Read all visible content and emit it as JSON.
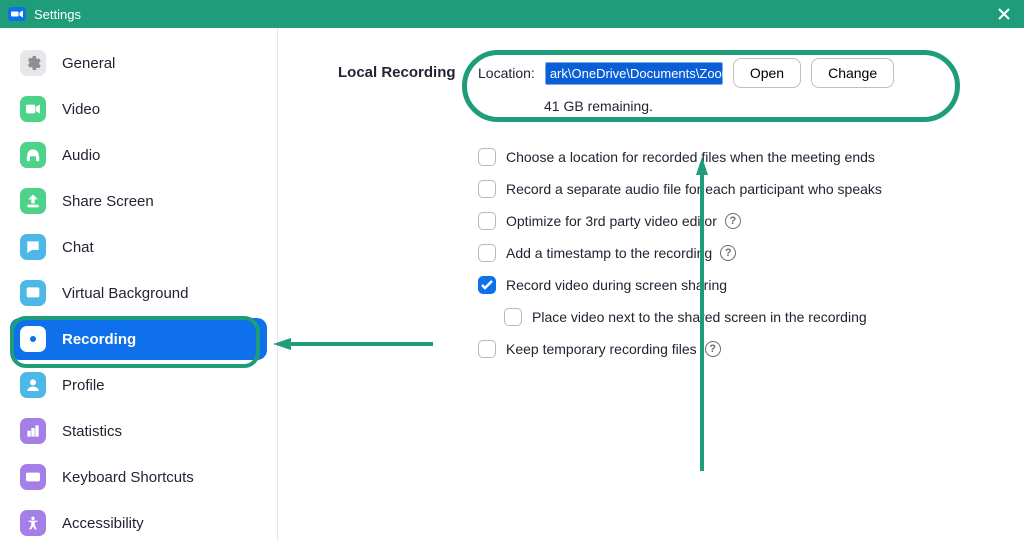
{
  "window": {
    "title": "Settings"
  },
  "sidebar": {
    "items": [
      {
        "label": "General",
        "icon": "gear",
        "active": false,
        "bg": "#e7e7ea",
        "fg": "#9aa0a6"
      },
      {
        "label": "Video",
        "icon": "video",
        "active": false,
        "bg": "#4dd28a",
        "fg": "#fff"
      },
      {
        "label": "Audio",
        "icon": "headphones",
        "active": false,
        "bg": "#4dd28a",
        "fg": "#fff"
      },
      {
        "label": "Share Screen",
        "icon": "share",
        "active": false,
        "bg": "#4dd28a",
        "fg": "#fff"
      },
      {
        "label": "Chat",
        "icon": "chat",
        "active": false,
        "bg": "#4db7e8",
        "fg": "#fff"
      },
      {
        "label": "Virtual Background",
        "icon": "image",
        "active": false,
        "bg": "#4db7e8",
        "fg": "#fff"
      },
      {
        "label": "Recording",
        "icon": "record",
        "active": true,
        "bg": "#0e71eb",
        "fg": "#fff"
      },
      {
        "label": "Profile",
        "icon": "person",
        "active": false,
        "bg": "#4db7e8",
        "fg": "#fff"
      },
      {
        "label": "Statistics",
        "icon": "stats",
        "active": false,
        "bg": "#a57fe8",
        "fg": "#fff"
      },
      {
        "label": "Keyboard Shortcuts",
        "icon": "keyboard",
        "active": false,
        "bg": "#a57fe8",
        "fg": "#fff"
      },
      {
        "label": "Accessibility",
        "icon": "access",
        "active": false,
        "bg": "#a57fe8",
        "fg": "#fff"
      }
    ]
  },
  "recording": {
    "section_label": "Local Recording",
    "location_label": "Location:",
    "location_path": "ark\\OneDrive\\Documents\\Zoom",
    "open_btn": "Open",
    "change_btn": "Change",
    "remaining": "41 GB remaining.",
    "options": [
      {
        "label": "Choose a location for recorded files when the meeting ends",
        "checked": false,
        "help": false,
        "indent": false
      },
      {
        "label": "Record a separate audio file for each participant who speaks",
        "checked": false,
        "help": false,
        "indent": false
      },
      {
        "label": "Optimize for 3rd party video editor",
        "checked": false,
        "help": true,
        "indent": false
      },
      {
        "label": "Add a timestamp to the recording",
        "checked": false,
        "help": true,
        "indent": false
      },
      {
        "label": "Record video during screen sharing",
        "checked": true,
        "help": false,
        "indent": false
      },
      {
        "label": "Place video next to the shared screen in the recording",
        "checked": false,
        "help": false,
        "indent": true
      },
      {
        "label": "Keep temporary recording files",
        "checked": false,
        "help": true,
        "indent": false
      }
    ]
  },
  "annotations": {
    "color": "#1f9d7a"
  }
}
